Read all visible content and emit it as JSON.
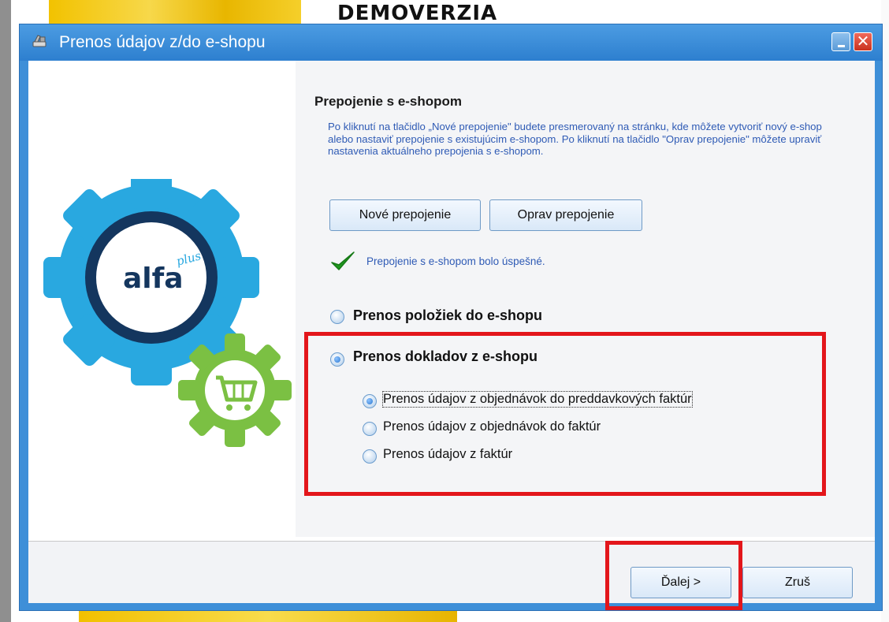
{
  "background": {
    "title": "DEMOVERZIA"
  },
  "window": {
    "title": "Prenos údajov z/do e-shopu",
    "icon": "tools-icon",
    "minimize_icon": "minimize-icon",
    "close_icon": "close-icon",
    "close_glyph": "✕"
  },
  "logo": {
    "brand": "alfa",
    "superscript": "plus",
    "icons": [
      "gear-icon",
      "shopping-cart-icon"
    ]
  },
  "connection": {
    "heading": "Prepojenie s e-shopom",
    "description": "Po kliknutí na tlačidlo „Nové prepojenie\" budete presmerovaný na stránku, kde môžete vytvoriť nový e-shop alebo nastaviť prepojenie s existujúcim e-shopom. Po kliknutí na tlačidlo \"Oprav prepojenie\" môžete upraviť nastavenia aktuálneho prepojenia s e-shopom.",
    "new_button": "Nové prepojenie",
    "fix_button": "Oprav prepojenie",
    "status_icon": "checkmark-icon",
    "status_text": "Prepojenie s e-shopom bolo úspešné."
  },
  "options": {
    "export_items": {
      "label": "Prenos položiek do e-shopu",
      "checked": false
    },
    "import_docs": {
      "label": "Prenos dokladov z e-shopu",
      "checked": true
    },
    "sub": [
      {
        "label": "Prenos údajov z objednávok do preddavkových faktúr",
        "checked": true
      },
      {
        "label": "Prenos údajov z objednávok do faktúr",
        "checked": false
      },
      {
        "label": "Prenos údajov z faktúr",
        "checked": false
      }
    ]
  },
  "footer": {
    "next_button": "Ďalej >",
    "cancel_button": "Zruš"
  },
  "colors": {
    "titlebar": "#3e8fd8",
    "description_text": "#2f5bb5",
    "highlight": "#e3161b",
    "gear_blue": "#29a8e0",
    "gear_navy": "#14365e",
    "gear_green": "#7bc043"
  }
}
